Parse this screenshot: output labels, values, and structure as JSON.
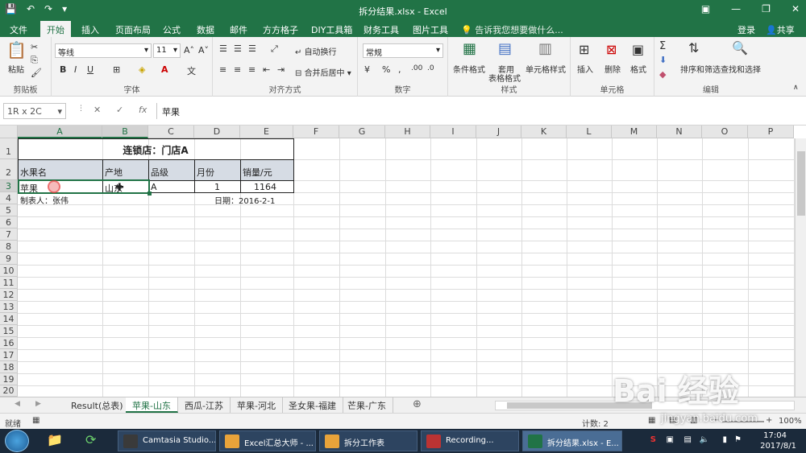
{
  "window": {
    "title": "拆分结果.xlsx - Excel"
  },
  "ribbon_tabs": [
    "文件",
    "开始",
    "插入",
    "页面布局",
    "公式",
    "数据",
    "邮件",
    "方方格子",
    "DIY工具箱",
    "财务工具",
    "图片工具"
  ],
  "tell_me": "告诉我您想要做什么...",
  "login": "登录",
  "share": "共享",
  "ribbon": {
    "clipboard": {
      "paste": "粘贴",
      "label": "剪贴板"
    },
    "font": {
      "name": "等线",
      "size": "11",
      "label": "字体"
    },
    "alignment": {
      "wrap": "自动换行",
      "merge": "合并后居中",
      "label": "对齐方式"
    },
    "number": {
      "format": "常规",
      "label": "数字"
    },
    "styles": {
      "conditional": "条件格式",
      "table_format_1": "套用",
      "table_format_2": "表格格式",
      "cell_styles": "单元格样式",
      "label": "样式"
    },
    "cells": {
      "insert": "插入",
      "delete": "删除",
      "format": "格式",
      "label": "单元格"
    },
    "editing": {
      "sort": "排序和筛选",
      "find": "查找和选择",
      "label": "编辑"
    }
  },
  "formula_bar": {
    "name_box": "1R x 2C",
    "value": "苹果"
  },
  "columns": [
    "A",
    "B",
    "C",
    "D",
    "E",
    "F",
    "G",
    "H",
    "I",
    "J",
    "K",
    "L",
    "M",
    "N",
    "O",
    "P"
  ],
  "rows": [
    "1",
    "2",
    "3",
    "4",
    "5",
    "6",
    "7",
    "8",
    "9",
    "10",
    "11",
    "12",
    "13",
    "14",
    "15",
    "16",
    "17",
    "18",
    "19",
    "20"
  ],
  "sheet": {
    "title": "连锁店：门店A",
    "headers": [
      "水果名",
      "产地",
      "品级",
      "月份",
      "销量/元"
    ],
    "row3": {
      "name": "苹果",
      "origin": "山东",
      "grade": "A",
      "month": "1",
      "sales": "1164"
    },
    "maker": "制表人：张伟",
    "date": "日期：2016-2-1"
  },
  "sheet_tabs": [
    "Result(总表)",
    "苹果-山东",
    "西瓜-江苏",
    "苹果-河北",
    "圣女果-福建",
    "芒果-广东"
  ],
  "status": {
    "mode": "就绪",
    "count": "计数: 2",
    "zoom": "100%"
  },
  "taskbar": {
    "items": [
      "Camtasia Studio...",
      "Excel汇总大师 - ...",
      "拆分工作表",
      "Recording...",
      "拆分结果.xlsx - E..."
    ],
    "clock_time": "17:04",
    "clock_date": "2017/8/1"
  },
  "watermark": {
    "text": "Bai 经验",
    "url": "jingyan.baidu.com"
  },
  "colors": {
    "accent": "#217346",
    "taskbar": "#1b2a3b",
    "header_fill": "#d6dce4"
  }
}
